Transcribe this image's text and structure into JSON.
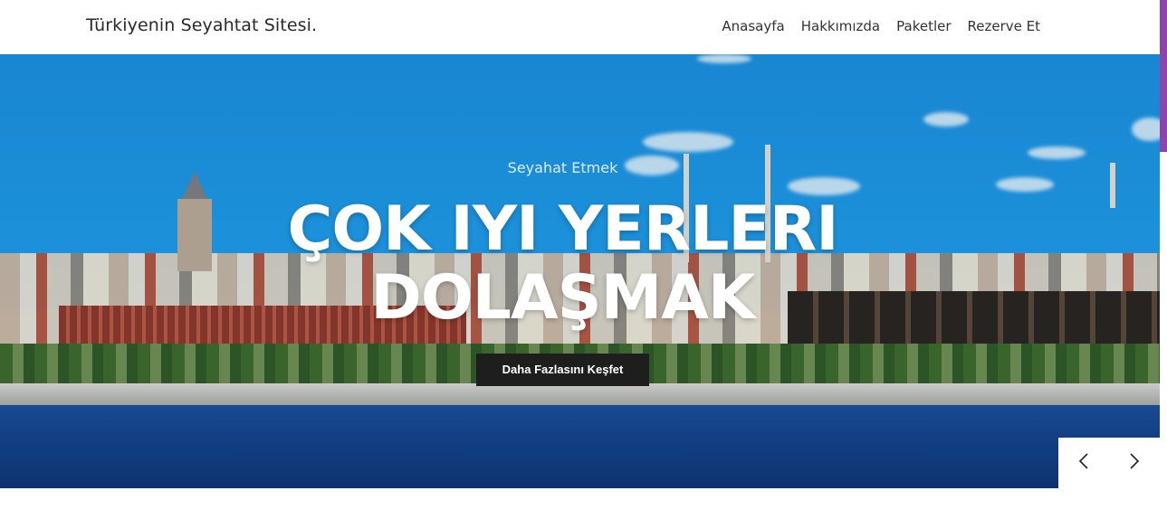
{
  "navbar": {
    "brand": "Türkiyenin Seyahtat Sitesi.",
    "links": [
      "Anasayfa",
      "Hakkımızda",
      "Paketler",
      "Rezerve Et"
    ]
  },
  "hero": {
    "subtitle": "Seyahat Etmek",
    "headline_line1": "ÇOK IYI YERLERI",
    "headline_line2": "DOLAŞMAK",
    "cta_label": "Daha Fazlasını Keşfet"
  },
  "slider": {
    "prev_icon": "chevron-left-icon",
    "next_icon": "chevron-right-icon"
  },
  "colors": {
    "scrollbar_thumb": "#8e44ad",
    "cta_background": "#1e1e1e"
  }
}
